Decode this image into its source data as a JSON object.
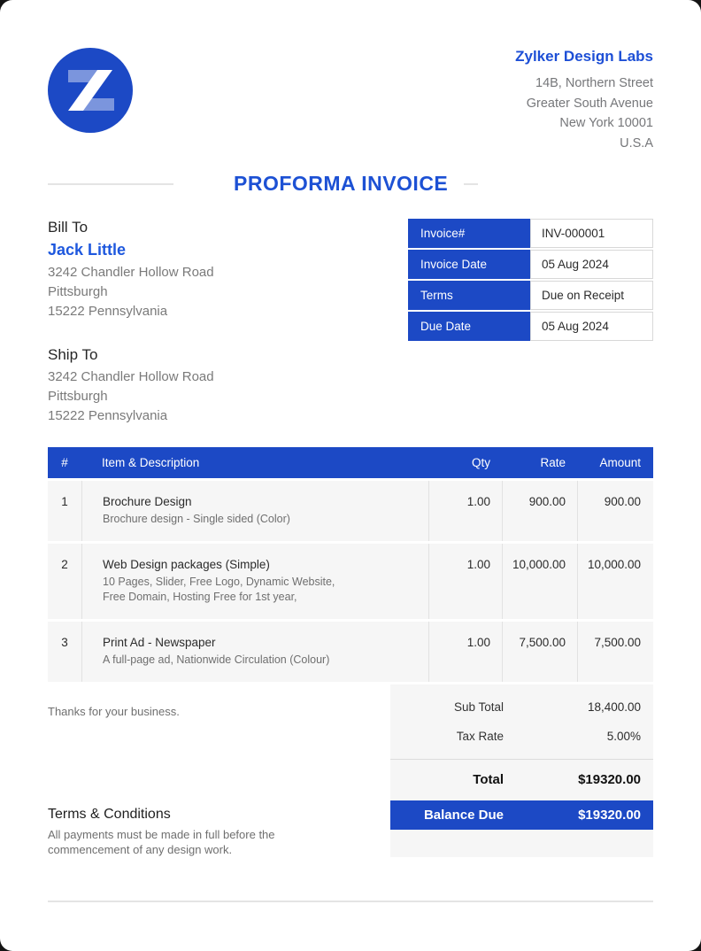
{
  "colors": {
    "brand_blue": "#1c49c5",
    "link_blue": "#1e58de",
    "title_blue": "#1d51d4",
    "row_bg": "#f6f6f6",
    "text_gray": "#7a7a7a",
    "text_dark": "#262626"
  },
  "header": {
    "logo_letter": "Z",
    "company": {
      "name": "Zylker Design Labs",
      "address_lines": [
        "14B, Northern Street",
        "Greater South Avenue",
        "New York 10001",
        "U.S.A"
      ]
    }
  },
  "title": "PROFORMA INVOICE",
  "bill_to": {
    "label": "Bill To",
    "name": "Jack Little",
    "address_lines": [
      "3242 Chandler Hollow Road",
      "Pittsburgh",
      "15222 Pennsylvania"
    ]
  },
  "ship_to": {
    "label": "Ship To",
    "address_lines": [
      "3242 Chandler Hollow Road",
      "Pittsburgh",
      "15222 Pennsylvania"
    ]
  },
  "invoice_meta": {
    "rows": [
      {
        "label": "Invoice#",
        "value": "INV-000001"
      },
      {
        "label": "Invoice Date",
        "value": "05 Aug 2024"
      },
      {
        "label": "Terms",
        "value": "Due on Receipt"
      },
      {
        "label": "Due Date",
        "value": "05 Aug 2024"
      }
    ]
  },
  "items_table": {
    "headers": {
      "num": "#",
      "desc": "Item & Description",
      "qty": "Qty",
      "rate": "Rate",
      "amount": "Amount"
    },
    "rows": [
      {
        "num": "1",
        "name": "Brochure Design",
        "desc_lines": [
          "Brochure design - Single sided (Color)"
        ],
        "qty": "1.00",
        "rate": "900.00",
        "amount": "900.00"
      },
      {
        "num": "2",
        "name": "Web Design packages (Simple)",
        "desc_lines": [
          "10 Pages, Slider, Free Logo, Dynamic Website,",
          "Free Domain, Hosting Free for 1st year,"
        ],
        "qty": "1.00",
        "rate": "10,000.00",
        "amount": "10,000.00"
      },
      {
        "num": "3",
        "name": "Print Ad - Newspaper",
        "desc_lines": [
          "A full-page ad, Nationwide Circulation (Colour)"
        ],
        "qty": "1.00",
        "rate": "7,500.00",
        "amount": "7,500.00"
      }
    ]
  },
  "footer": {
    "thanks": "Thanks for your business.",
    "totals": [
      {
        "label": "Sub Total",
        "value": "18,400.00"
      },
      {
        "label": "Tax Rate",
        "value": "5.00%"
      }
    ],
    "total": {
      "label": "Total",
      "value": "$19320.00"
    },
    "balance_due": {
      "label": "Balance Due",
      "value": "$19320.00"
    },
    "terms": {
      "heading": "Terms & Conditions",
      "body_lines": [
        "All payments must be made in full before the",
        "commencement of any design work."
      ]
    }
  }
}
